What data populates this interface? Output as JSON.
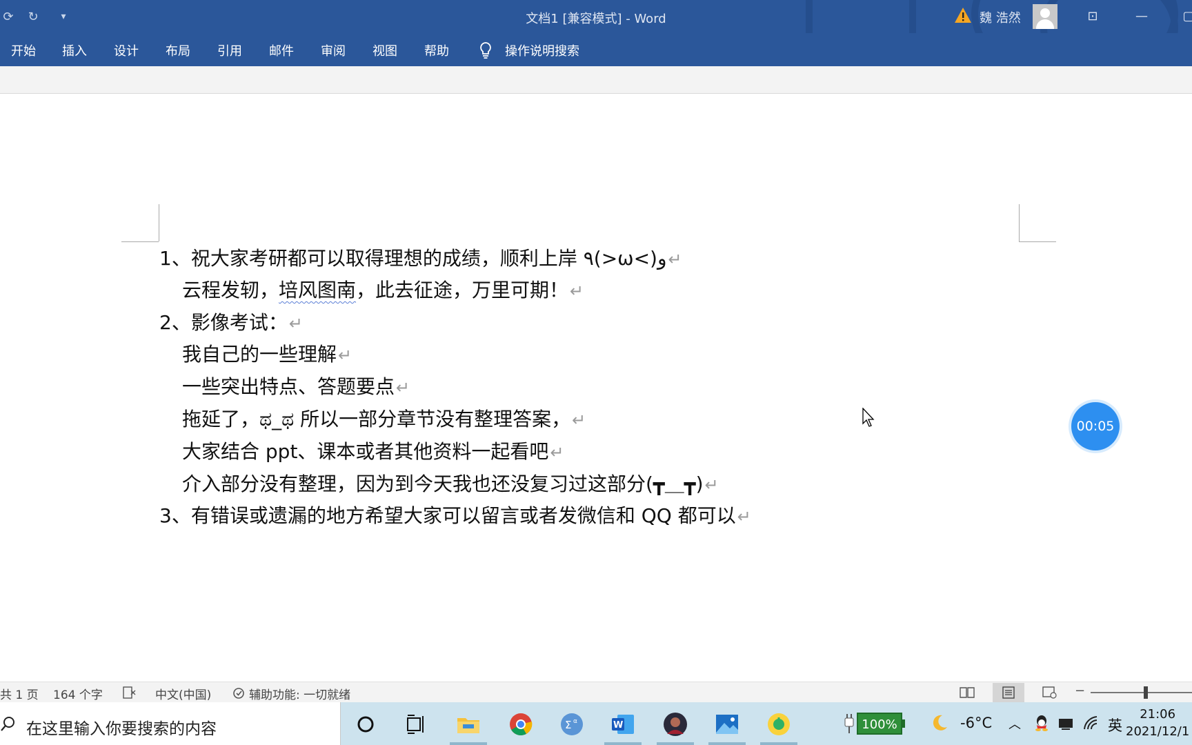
{
  "window": {
    "title": "文档1 [兼容模式]  -  Word",
    "user_name": "魏 浩然"
  },
  "ribbon": {
    "tabs": [
      "开始",
      "插入",
      "设计",
      "布局",
      "引用",
      "邮件",
      "审阅",
      "视图",
      "帮助"
    ],
    "tell_me": "操作说明搜索"
  },
  "document": {
    "lines": [
      "1、祝大家考研都可以取得理想的成绩，顺利上岸 ٩(>ω<)و",
      "云程发轫，",
      "培风图南",
      "，此去征途，万里可期！",
      "2、影像考试：",
      "我自己的一些理解",
      "一些突出特点、答题要点",
      "拖延了，ಥ_ಥ 所以一部分章节没有整理答案，",
      "大家结合 ppt、课本或者其他资料一起看吧",
      "介入部分没有整理，因为到今天我也还没复习过这部分(┳＿┳)",
      "3、有错误或遗漏的地方希望大家可以留言或者发微信和 QQ 都可以"
    ],
    "paragraph_mark": "↵"
  },
  "timer": "00:05",
  "status_bar": {
    "page": "共 1 页",
    "words": "164 个字",
    "language": "中文(中国)",
    "accessibility": "辅助功能: 一切就绪"
  },
  "taskbar": {
    "search_placeholder": "在这里输入你要搜索的内容",
    "battery": "100%",
    "temperature": "-6°C",
    "ime": "英",
    "time": "21:06",
    "date": "2021/12/1"
  },
  "colors": {
    "title_blue": "#2b579a",
    "timer_blue": "#2d8ff0",
    "taskbar": "#cde3ee"
  }
}
